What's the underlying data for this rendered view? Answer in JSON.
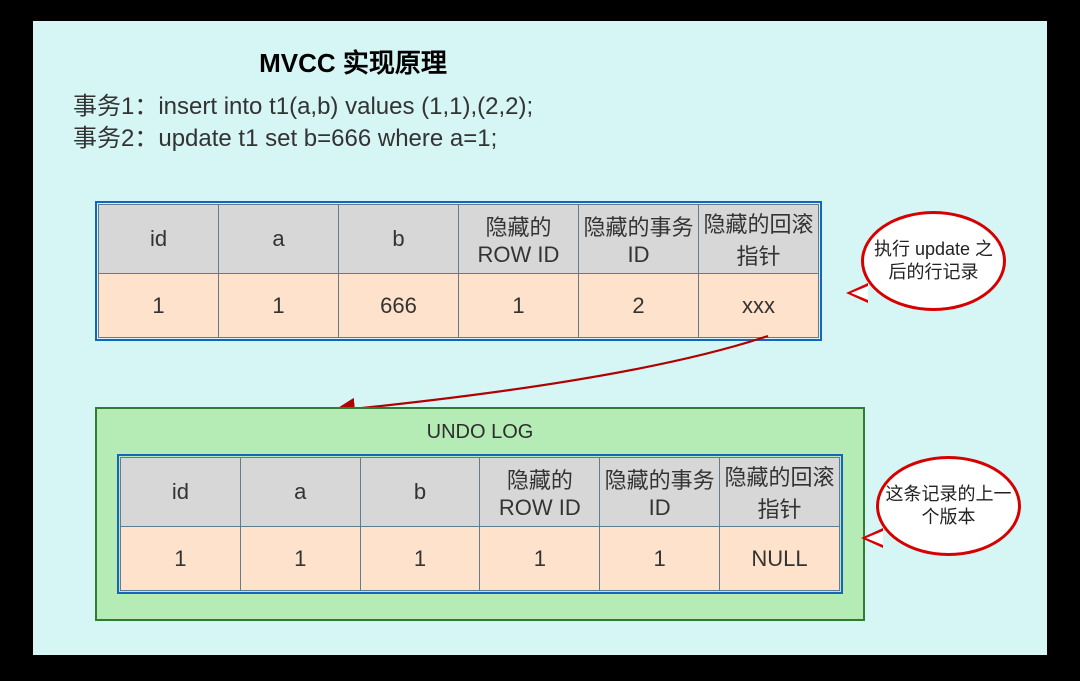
{
  "title": "MVCC 实现原理",
  "statements": {
    "line1": "事务1：insert into t1(a,b) values (1,1),(2,2);",
    "line2": "事务2：update t1 set b=666 where a=1;"
  },
  "table1": {
    "headers": [
      "id",
      "a",
      "b",
      "隐藏的ROW ID",
      "隐藏的事务ID",
      "隐藏的回滚指针"
    ],
    "row": [
      "1",
      "1",
      "666",
      "1",
      "2",
      "xxx"
    ]
  },
  "undo": {
    "title": "UNDO LOG",
    "headers": [
      "id",
      "a",
      "b",
      "隐藏的ROW ID",
      "隐藏的事务ID",
      "隐藏的回滚指针"
    ],
    "row": [
      "1",
      "1",
      "1",
      "1",
      "1",
      "NULL"
    ]
  },
  "callouts": {
    "c1": "执行 update 之后的行记录",
    "c2": "这条记录的上一个版本"
  }
}
